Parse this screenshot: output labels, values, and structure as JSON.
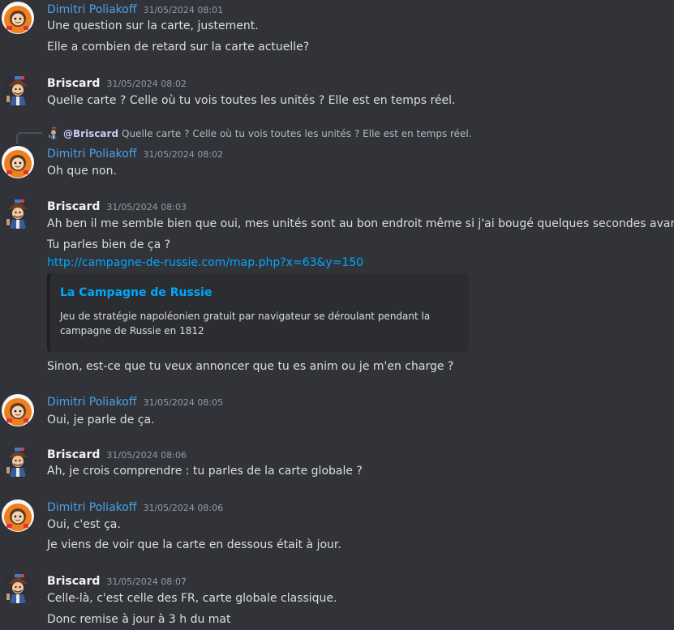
{
  "users": {
    "dimitri": "Dimitri Poliakoff",
    "briscard": "Briscard"
  },
  "messages": [
    {
      "author": "Dimitri Poliakoff",
      "time": "31/05/2024 08:01",
      "lines": [
        "Une question sur la carte, justement.",
        "Elle a combien de retard sur la carte actuelle?"
      ]
    },
    {
      "author": "Briscard",
      "time": "31/05/2024 08:02",
      "lines": [
        "Quelle carte ? Celle où tu vois toutes les unités ? Elle est en temps réel."
      ]
    },
    {
      "author": "Dimitri Poliakoff",
      "time": "31/05/2024 08:02",
      "reply": {
        "mention": "@Briscard",
        "text": "Quelle carte ? Celle où tu vois toutes les unités ? Elle est en temps réel."
      },
      "lines": [
        "Oh que non."
      ]
    },
    {
      "author": "Briscard",
      "time": "31/05/2024 08:03",
      "lines": [
        "Ah ben il me semble bien que oui, mes unités sont au bon endroit même si j'ai bougé quelques secondes avant...",
        "Tu parles bien de ça ?"
      ],
      "link": "http://campagne-de-russie.com/map.php?x=63&y=150",
      "embed": {
        "title": "La Campagne de Russie",
        "description": "Jeu de stratégie napoléonien gratuit par navigateur se déroulant pendant la campagne de Russie en 1812"
      },
      "after": "Sinon, est-ce que tu veux annoncer que tu es anim ou je m'en charge ?"
    },
    {
      "author": "Dimitri Poliakoff",
      "time": "31/05/2024 08:05",
      "lines": [
        "Oui, je parle de ça."
      ]
    },
    {
      "author": "Briscard",
      "time": "31/05/2024 08:06",
      "lines": [
        "Ah, je crois comprendre : tu parles de la carte globale ?"
      ]
    },
    {
      "author": "Dimitri Poliakoff",
      "time": "31/05/2024 08:06",
      "lines": [
        "Oui, c'est ça.",
        "Je viens de voir que la carte en dessous était à jour."
      ]
    },
    {
      "author": "Briscard",
      "time": "31/05/2024 08:07",
      "lines": [
        "Celle-là, c'est celle des FR, carte globale classique.",
        "Donc remise à jour à 3 h du mat"
      ]
    }
  ],
  "colors": {
    "background": "#313338",
    "dimitri_name": "#4aa3e8",
    "link": "#00a8fc",
    "embed_bg": "#2b2d31"
  },
  "icons": {
    "dimitri_avatar": "cartoon-orange-hood-avatar",
    "briscard_avatar": "pirate-character-avatar"
  }
}
